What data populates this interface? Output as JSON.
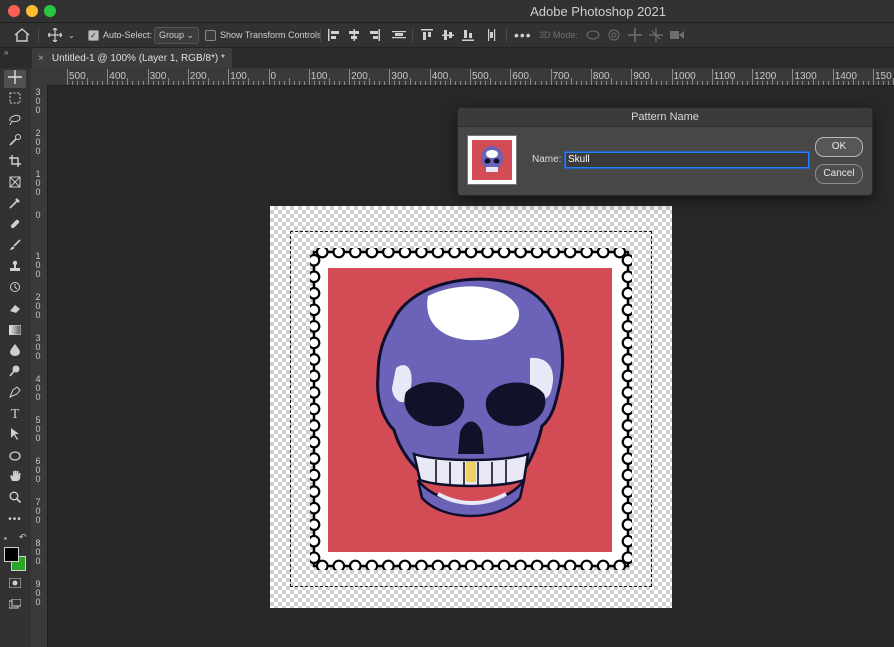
{
  "window": {
    "title": "Adobe Photoshop 2021"
  },
  "options_bar": {
    "auto_select_label": "Auto-Select:",
    "auto_select_checked": true,
    "auto_select_target": "Group",
    "show_transform_label": "Show Transform Controls",
    "show_transform_checked": false,
    "three_d_mode_label": "3D Mode:"
  },
  "document_tab": {
    "title": "Untitled-1 @ 100% (Layer 1, RGB/8*) *",
    "close": "×"
  },
  "ruler_top": {
    "labels": [
      "500",
      "400",
      "300",
      "200",
      "100",
      "0",
      "100",
      "200",
      "300",
      "400",
      "500",
      "600",
      "700",
      "800",
      "900",
      "1000",
      "1100",
      "1200",
      "1300",
      "1400",
      "150"
    ]
  },
  "ruler_left": {
    "labels": [
      [
        "3",
        "0",
        "0"
      ],
      [
        "2",
        "0",
        "0"
      ],
      [
        "1",
        "0",
        "0"
      ],
      [
        "0"
      ],
      [
        "1",
        "0",
        "0"
      ],
      [
        "2",
        "0",
        "0"
      ],
      [
        "3",
        "0",
        "0"
      ],
      [
        "4",
        "0",
        "0"
      ],
      [
        "5",
        "0",
        "0"
      ],
      [
        "6",
        "0",
        "0"
      ],
      [
        "7",
        "0",
        "0"
      ],
      [
        "8",
        "0",
        "0"
      ],
      [
        "9",
        "0",
        "0"
      ]
    ]
  },
  "tools": [
    "move",
    "marquee",
    "lasso",
    "quick-select",
    "crop",
    "frame",
    "eyedropper",
    "healing",
    "brush",
    "stamp",
    "history-brush",
    "eraser",
    "gradient",
    "blur",
    "dodge",
    "pen",
    "type",
    "path-select",
    "shape",
    "hand",
    "zoom",
    "more"
  ],
  "colors": {
    "foreground": "#000000",
    "background": "#2aa52a",
    "stamp_bg": "#d24b55",
    "skull": "#6a63b8"
  },
  "dialog": {
    "title": "Pattern Name",
    "name_label": "Name:",
    "name_value": "Skull",
    "ok_label": "OK",
    "cancel_label": "Cancel"
  }
}
